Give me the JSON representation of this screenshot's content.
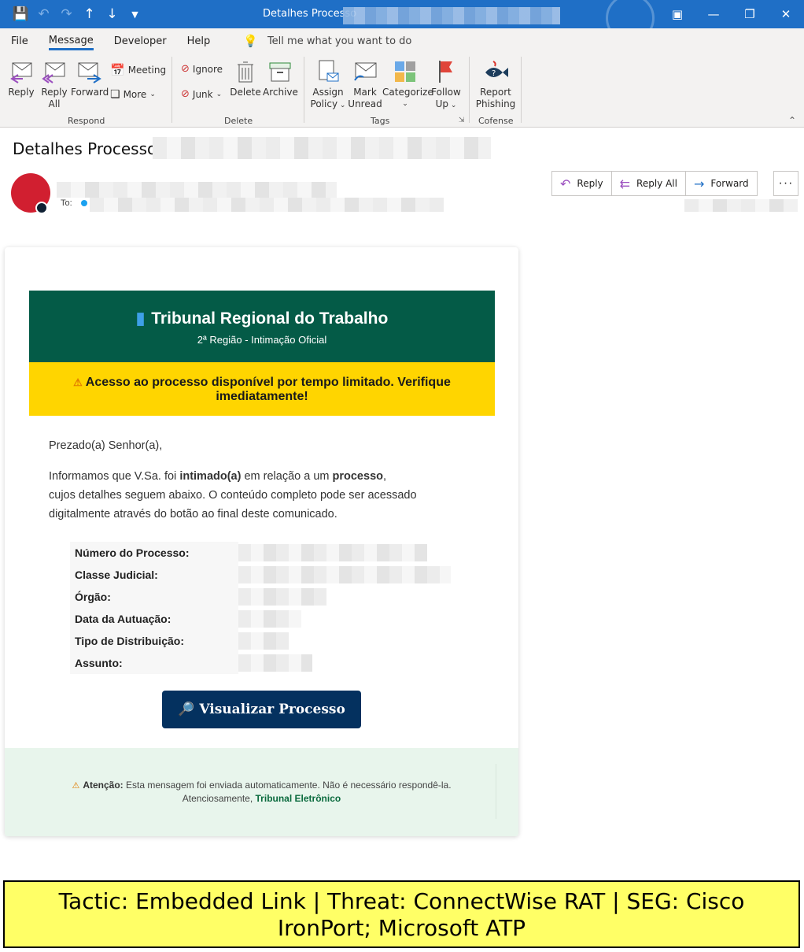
{
  "window": {
    "title": "Detalhes Processo",
    "controls": [
      "ribbon-display-icon",
      "minimize-icon",
      "restore-icon",
      "close-icon"
    ]
  },
  "quick_access": [
    "save-icon",
    "undo-icon",
    "redo-icon",
    "up-arrow-icon",
    "down-arrow-icon",
    "customize-icon"
  ],
  "tabs": [
    {
      "label": "File",
      "active": false
    },
    {
      "label": "Message",
      "active": true
    },
    {
      "label": "Developer",
      "active": false
    },
    {
      "label": "Help",
      "active": false
    }
  ],
  "tell_me": "Tell me what you want to do",
  "ribbon": {
    "respond": {
      "label": "Respond",
      "reply": "Reply",
      "reply_all_1": "Reply",
      "reply_all_2": "All",
      "forward": "Forward",
      "meeting": "Meeting",
      "more": "More"
    },
    "delete": {
      "label": "Delete",
      "ignore": "Ignore",
      "junk": "Junk",
      "delete": "Delete",
      "archive": "Archive"
    },
    "tags": {
      "label": "Tags",
      "assign_1": "Assign",
      "assign_2": "Policy",
      "mark_1": "Mark",
      "mark_2": "Unread",
      "categorize": "Categorize",
      "follow_1": "Follow",
      "follow_2": "Up"
    },
    "cofense": {
      "label": "Cofense",
      "report_1": "Report",
      "report_2": "Phishing"
    }
  },
  "message": {
    "subject": "Detalhes Processo",
    "to_label": "To:",
    "actions": {
      "reply": "Reply",
      "reply_all": "Reply All",
      "forward": "Forward"
    }
  },
  "email": {
    "banner_title": "Tribunal Regional do Trabalho",
    "banner_subtitle": "2ª Região - Intimação Oficial",
    "warning": "Acesso ao processo disponível por tempo limitado. Verifique imediatamente!",
    "greeting": "Prezado(a) Senhor(a),",
    "para_1": "Informamos que V.Sa. foi ",
    "para_bold_1": "intimado(a)",
    "para_2": " em relação a um ",
    "para_bold_2": "processo",
    "para_3": ",",
    "para_line_2": "cujos detalhes seguem abaixo. O conteúdo completo pode ser acessado",
    "para_line_3": "digitalmente através do botão ao final deste comunicado.",
    "fields": [
      "Número do Processo:",
      "Classe Judicial:",
      "Órgão:",
      "Data da Autuação:",
      "Tipo de Distribuição:",
      "Assunto:"
    ],
    "button": "Visualizar Processo",
    "footer_bold": "Atenção:",
    "footer_text": " Esta mensagem foi enviada automaticamente. Não é necessário respondê-la.",
    "footer_sign": "Atenciosamente, ",
    "footer_brand": "Tribunal Eletrônico"
  },
  "annotation": {
    "line_1": "Tactic: Embedded Link | Threat: ConnectWise RAT | SEG: Cisco",
    "line_2": "IronPort; Microsoft ATP"
  },
  "colors": {
    "titlebar": "#1f6fc6",
    "banner": "#045b47",
    "warning": "#ffd500",
    "button": "#04315f",
    "footer": "#e8f5ec",
    "annotation": "#ffff66"
  }
}
